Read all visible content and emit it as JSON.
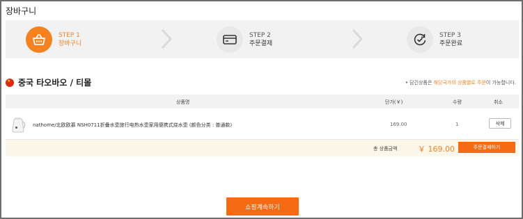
{
  "page": {
    "title": "장바구니"
  },
  "steps": [
    {
      "num": "STEP 1",
      "label": "장바구니",
      "icon": "basket-icon",
      "active": true
    },
    {
      "num": "STEP 2",
      "label": "주문결제",
      "icon": "card-icon",
      "active": false
    },
    {
      "num": "STEP 3",
      "label": "주문완료",
      "icon": "check-cycle-icon",
      "active": false
    }
  ],
  "shop": {
    "title": "중국 타오바오 / 티몰",
    "flag": "china-flag-icon"
  },
  "notice": {
    "prefix": "• 담긴상품은 ",
    "highlight": "해당국가의 상품별로 주문",
    "suffix": "이 가능합니다."
  },
  "table": {
    "headers": {
      "product": "상품명",
      "unit_price": "단가(￥)",
      "qty": "수량",
      "cancel": "취소"
    },
    "items": [
      {
        "name": "nathome/北欧欧慕 NSH0711折叠水壶旅行电热水壶家用便携式烧水壶 (颜色分类 : 普通款)",
        "price": "169.00",
        "qty": "1",
        "delete_label": "삭제"
      }
    ]
  },
  "total": {
    "label": "총 상품금액",
    "value": "￥ 169.00",
    "order_label": "주문결제하기"
  },
  "continue_label": "쇼핑계속하기",
  "colors": {
    "accent": "#f5821f",
    "button": "#f56a12",
    "step_bg": "#f2f2f2",
    "total_bg": "#fcf7e8"
  }
}
